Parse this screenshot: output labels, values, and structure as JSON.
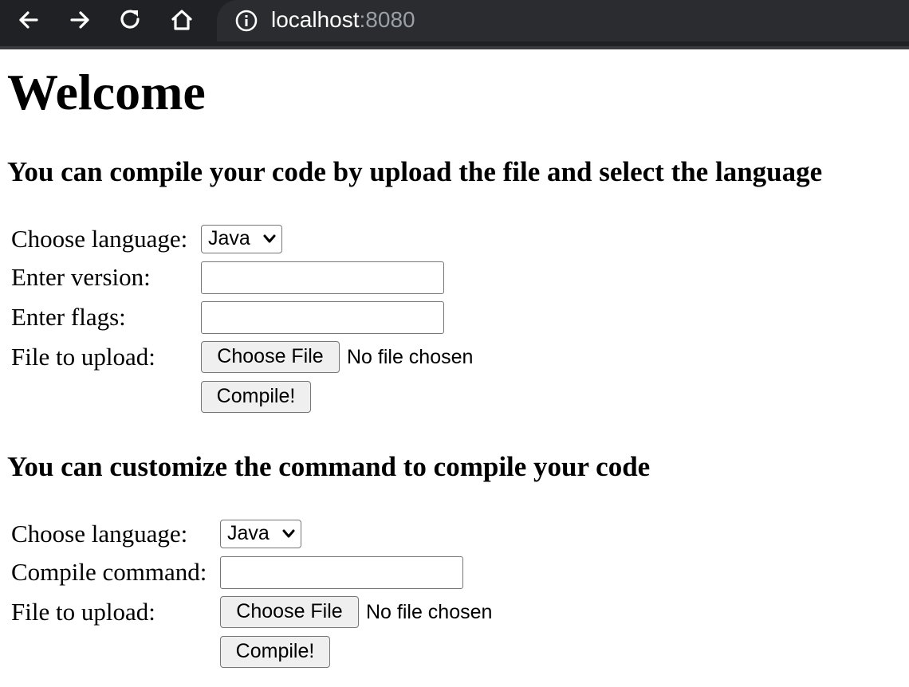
{
  "browser": {
    "url_host": "localhost",
    "url_port": ":8080"
  },
  "page": {
    "title": "Welcome",
    "section1": {
      "heading": "You can compile your code by upload the file and select the language",
      "language_label": "Choose language:",
      "language_value": "Java",
      "version_label": "Enter version:",
      "version_value": "",
      "flags_label": "Enter flags:",
      "flags_value": "",
      "file_label": "File to upload:",
      "choose_file_label": "Choose File",
      "no_file_text": "No file chosen",
      "compile_label": "Compile!"
    },
    "section2": {
      "heading": "You can customize the command to compile your code",
      "language_label": "Choose language:",
      "language_value": "Java",
      "command_label": "Compile command:",
      "command_value": "",
      "file_label": "File to upload:",
      "choose_file_label": "Choose File",
      "no_file_text": "No file chosen",
      "compile_label": "Compile!"
    }
  }
}
